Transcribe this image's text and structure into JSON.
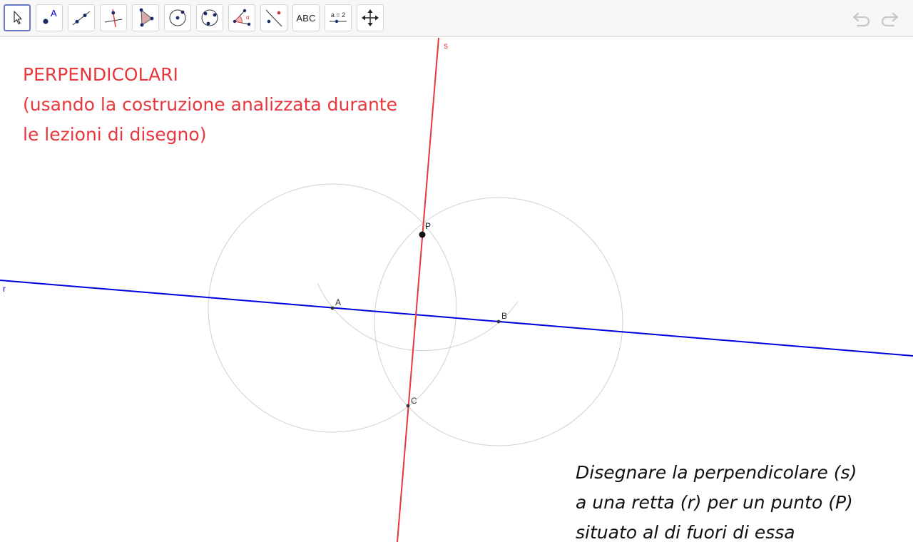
{
  "toolbar": {
    "tools": [
      {
        "name": "move-tool",
        "icon": "arrow-cursor-icon",
        "active": true
      },
      {
        "name": "point-tool",
        "icon": "point-icon",
        "glyph": "A"
      },
      {
        "name": "line-tool",
        "icon": "line-through-two-points-icon"
      },
      {
        "name": "perpendicular-line-tool",
        "icon": "perpendicular-line-icon"
      },
      {
        "name": "polygon-tool",
        "icon": "polygon-icon"
      },
      {
        "name": "circle-tool",
        "icon": "circle-with-center-icon"
      },
      {
        "name": "circle-through-three-points-tool",
        "icon": "circle-three-points-icon"
      },
      {
        "name": "angle-tool",
        "icon": "angle-icon",
        "glyph": "α"
      },
      {
        "name": "reflect-tool",
        "icon": "reflect-about-line-icon"
      },
      {
        "name": "text-tool",
        "icon": "text-icon",
        "label": "ABC"
      },
      {
        "name": "slider-tool",
        "icon": "slider-icon",
        "label": "a = 2"
      },
      {
        "name": "move-graphics-view-tool",
        "icon": "move-view-icon"
      }
    ],
    "undo_icon": "undo-icon",
    "redo_icon": "redo-icon"
  },
  "canvas": {
    "title_lines": [
      "PERPENDICOLARI",
      "(usando la costruzione analizzata durante",
      "le lezioni di disegno)"
    ],
    "description_lines": [
      "Disegnare la perpendicolare (s)",
      "a una retta (r) per un punto (P)",
      "situato al di fuori di essa"
    ],
    "lines": {
      "r": {
        "label": "r",
        "color": "#0000dd"
      },
      "s": {
        "label": "s",
        "color": "#e8383d"
      }
    },
    "points": {
      "P": {
        "label": "P"
      },
      "A": {
        "label": "A"
      },
      "B": {
        "label": "B"
      },
      "C": {
        "label": "C"
      }
    },
    "colors": {
      "construction": "#d0d0d0",
      "point": "#222222",
      "title": "#e8383d",
      "description": "#111111"
    }
  }
}
